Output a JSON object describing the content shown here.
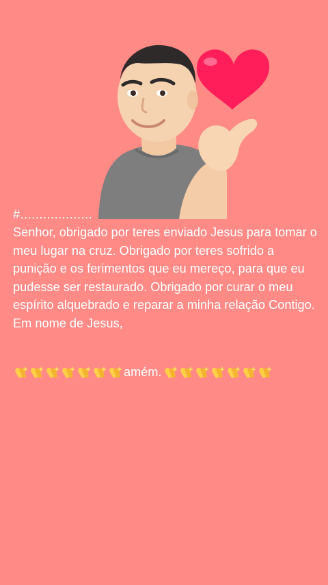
{
  "post": {
    "header_marker": "#...................",
    "body_text": "Senhor, obrigado por teres enviado Jesus para tomar o meu lugar na cruz. Obrigado por teres sofrido a punição e os ferimentos que eu mereço, para que eu pudesse ser restaurado. Obrigado por curar o meu espírito alquebrado e reparar a minha relação Contigo. Em nome de Jesus,",
    "amen_word": "amém.",
    "left_emoji_count": 7,
    "right_emoji_count": 7,
    "emoji_name": "praying-hands-with-sparkles-icon"
  },
  "colors": {
    "background": "#ff8a86",
    "text": "#ffffff",
    "heart": "#ff1e5a",
    "emoji": "#ffcf4a"
  },
  "sticker": {
    "name": "avatar-finger-heart-sticker"
  }
}
